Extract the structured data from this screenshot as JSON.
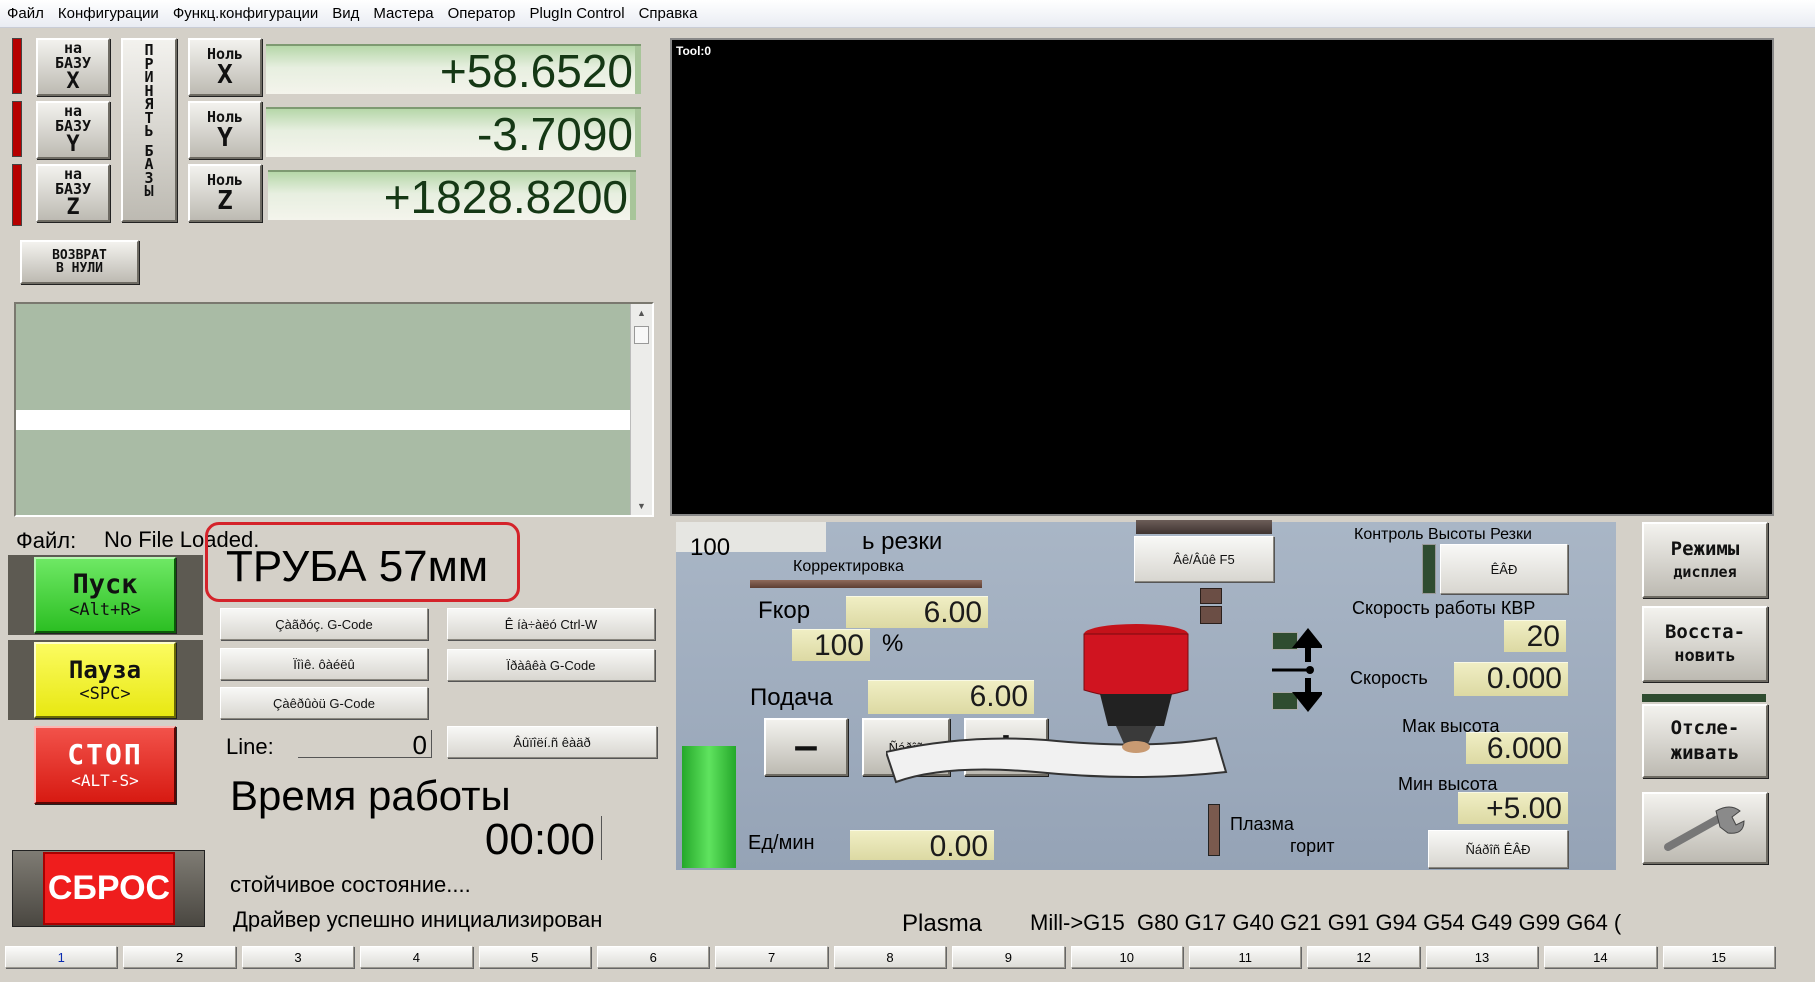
{
  "menu": [
    "Файл",
    "Конфигурации",
    "Функц.конфигурации",
    "Вид",
    "Мастера",
    "Оператор",
    "PlugIn Control",
    "Справка"
  ],
  "axes": [
    {
      "ref_top": "на",
      "ref_mid": "БАЗУ",
      "ref_axis": "X",
      "zero_top": "Ноль",
      "zero_axis": "X",
      "value": "+58.6520"
    },
    {
      "ref_top": "на",
      "ref_mid": "БАЗУ",
      "ref_axis": "Y",
      "zero_top": "Ноль",
      "zero_axis": "Y",
      "value": "-3.7090"
    },
    {
      "ref_top": "на",
      "ref_mid": "БАЗУ",
      "ref_axis": "Z",
      "zero_top": "Ноль",
      "zero_axis": "Z",
      "value": "+1828.8200"
    }
  ],
  "accept_base": [
    "П",
    "Р",
    "И",
    "Н",
    "Я",
    "Т",
    "Ь",
    "",
    "Б",
    "А",
    "З",
    "Ы"
  ],
  "return_zero": {
    "line1": "ВОЗВРАТ",
    "line2": "В НУЛИ"
  },
  "toolpath": {
    "label": "Tool:0"
  },
  "file": {
    "label": "Файл:",
    "value": "No File Loaded."
  },
  "job_name": "ТРУБА 57мм",
  "run": {
    "start": {
      "label": "Пуск",
      "hotkey": "<Alt+R>"
    },
    "pause": {
      "label": "Пауза",
      "hotkey": "<SPC>"
    },
    "stop": {
      "label": "СТОП",
      "hotkey": "<ALT-S>"
    },
    "reset": "СБРОС"
  },
  "gcode_buttons": [
    "Çàãðóç. G-Code",
    "Ê íà÷àëó Ctrl-W",
    "Ïîìê. ôàéëû",
    "Ïðàâêà G-Code",
    "Çàêðûòü G-Code",
    "Âûïîëí.ñ êàäð"
  ],
  "line": {
    "label": "Line:",
    "value": "0"
  },
  "runtime": {
    "label": "Время работы",
    "value": "00:00"
  },
  "status": [
    "стойчивое состояние....",
    "Драйвер успешно инициализирован"
  ],
  "plasma": {
    "speed_title": "ь резки",
    "speed_prefix": "100",
    "correction_label": "Корректировка",
    "fcor_label": "Fкор",
    "fcor_value": "6.00",
    "percent_value": "100",
    "percent_sign": "%",
    "feed_label": "Подача",
    "feed_value": "6.00",
    "minus": "—",
    "reset_btn": "Ñáðîñ",
    "plus": "+",
    "units_label": "Ед/мин",
    "units_value": "0.00",
    "top_btn": "Âê/Âûê F5",
    "thc_title": "Контроль Высоты Резки",
    "thc_btn": "ÊÂÐ",
    "thc_speed_label": "Скорость работы КВР",
    "thc_speed_value": "20",
    "speed_label": "Скорость",
    "speed_value": "0.000",
    "max_label": "Мак высота",
    "max_value": "6.000",
    "min_label": "Мин высота",
    "min_value": "+5.00",
    "plasma_on_1": "Плазма",
    "plasma_on_2": "горит",
    "thc_reset": "Ñáðîñ ÊÂÐ"
  },
  "right_buttons": [
    {
      "l1": "Режимы",
      "l2": "дисплея"
    },
    {
      "l1": "Восста-",
      "l2": "новить"
    },
    {
      "l1": "Отсле-",
      "l2": "живать"
    }
  ],
  "profile": "Plasma",
  "modal_codes": "Mill->G15  G80 G17 G40 G21 G91 G94 G54 G49 G99 G64 (",
  "tabs": [
    "1",
    "2",
    "3",
    "4",
    "5",
    "6",
    "7",
    "8",
    "9",
    "10",
    "11",
    "12",
    "13",
    "14",
    "15"
  ],
  "colors": {
    "start": "#39d22f",
    "pause": "#f2f21e",
    "stop": "#e3231b",
    "reset": "#ef1d1d",
    "dro": "#153815",
    "panel": "#a2b0c2"
  }
}
